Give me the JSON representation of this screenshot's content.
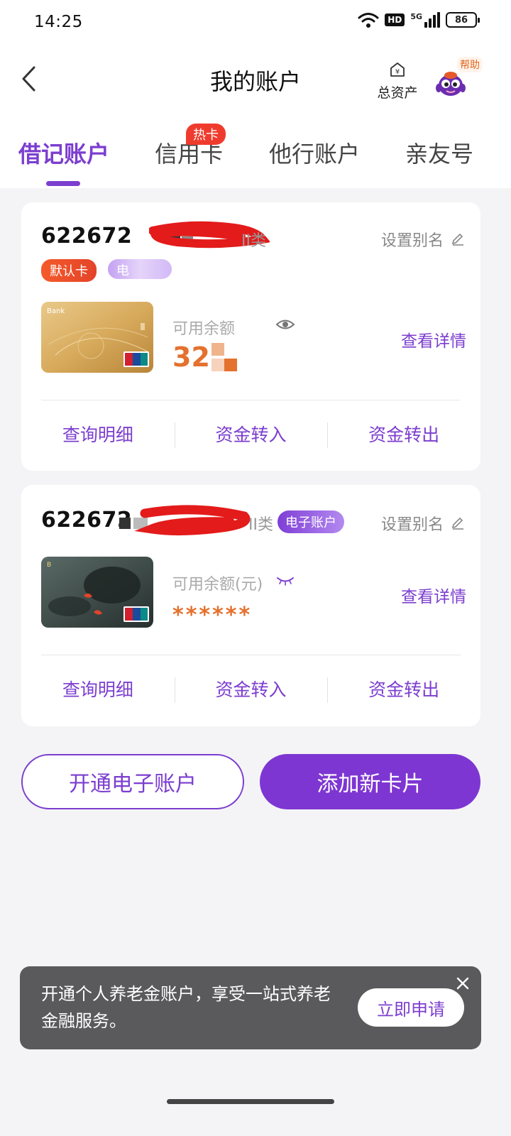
{
  "status_bar": {
    "time": "14:25",
    "hd_label": "HD",
    "network_label": "5G",
    "battery": "86",
    "icons": [
      "wifi-icon",
      "hd-icon",
      "signal-5g-icon",
      "battery-icon"
    ]
  },
  "header": {
    "title": "我的账户",
    "back_icon": "chevron-left-icon",
    "total_assets_label": "总资产",
    "total_assets_icon": "yuan-house-icon",
    "help_label": "帮助",
    "mascot_icon": "mascot-avatar-icon"
  },
  "tabs": [
    {
      "label": "借记账户",
      "active": true
    },
    {
      "label": "信用卡",
      "active": false,
      "badge": "热卡"
    },
    {
      "label": "他行账户",
      "active": false
    },
    {
      "label": "亲友号",
      "active": false
    }
  ],
  "accounts": [
    {
      "number": "622672",
      "class_label": "II类",
      "badges": [
        "默认卡",
        "电"
      ],
      "alias_label": "设置别名",
      "balance_label": "可用余额",
      "balance_value": "32.",
      "detail_label": "查看详情",
      "actions": [
        "查询明细",
        "资金转入",
        "资金转出"
      ],
      "card_style": "gold"
    },
    {
      "number": "622672",
      "class_label": "II类",
      "badges": [
        "电子账户"
      ],
      "alias_label": "设置别名",
      "balance_label": "可用余额(元)",
      "balance_value": "******",
      "detail_label": "查看详情",
      "actions": [
        "查询明细",
        "资金转入",
        "资金转出"
      ],
      "card_style": "lotus"
    }
  ],
  "buttons": {
    "open_e_account": "开通电子账户",
    "add_card": "添加新卡片"
  },
  "banner": {
    "text": "开通个人养老金账户，享受一站式养老金融服务。",
    "action": "立即申请",
    "close_icon": "close-icon"
  },
  "colors": {
    "accent": "#7c3ecf",
    "balance": "#e4712e",
    "hot_badge": "#ef3b2d",
    "banner_bg": "#5a5a5c"
  }
}
